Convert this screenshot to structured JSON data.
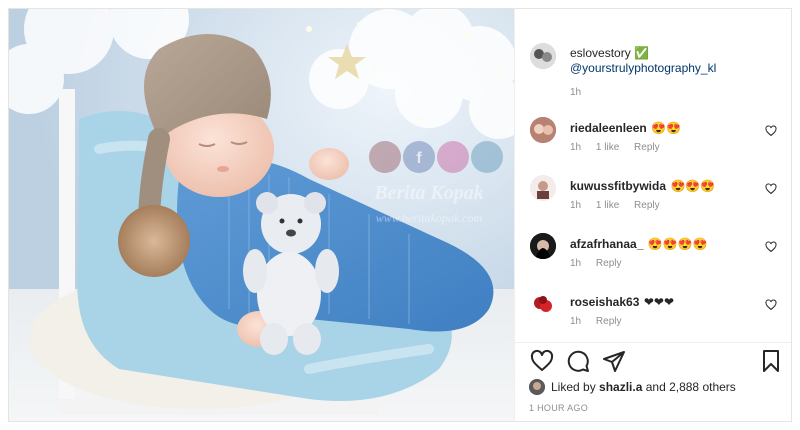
{
  "post": {
    "author": "eslovestory",
    "author_badge": "✅",
    "caption_mention": "@yourstrulyphotography_kl",
    "caption_time": "1h",
    "watermark_line1": "Berita Kopak",
    "watermark_line2": "www.beritakopak.com"
  },
  "comments": [
    {
      "user": "riedaleenleen",
      "text": "😍😍",
      "time": "1h",
      "likes": "1 like",
      "reply": "Reply"
    },
    {
      "user": "kuwussfitbywida",
      "text": "😍😍😍",
      "time": "1h",
      "likes": "1 like",
      "reply": "Reply"
    },
    {
      "user": "afzafrhanaa_",
      "text": "😍😍😍😍",
      "time": "1h",
      "likes": "",
      "reply": "Reply"
    },
    {
      "user": "roseishak63",
      "text": "❤❤❤",
      "time": "1h",
      "likes": "",
      "reply": "Reply"
    }
  ],
  "likes": {
    "prefix": "Liked by ",
    "user": "shazli.a",
    "suffix": " and 2,888 others"
  },
  "timestamp": "1 HOUR AGO",
  "icons": {
    "like": "heart-icon",
    "comment": "comment-icon",
    "share": "share-icon",
    "save": "bookmark-icon"
  },
  "colors": {
    "link": "#00376b",
    "muted": "#8e8e8e",
    "text": "#262626"
  }
}
